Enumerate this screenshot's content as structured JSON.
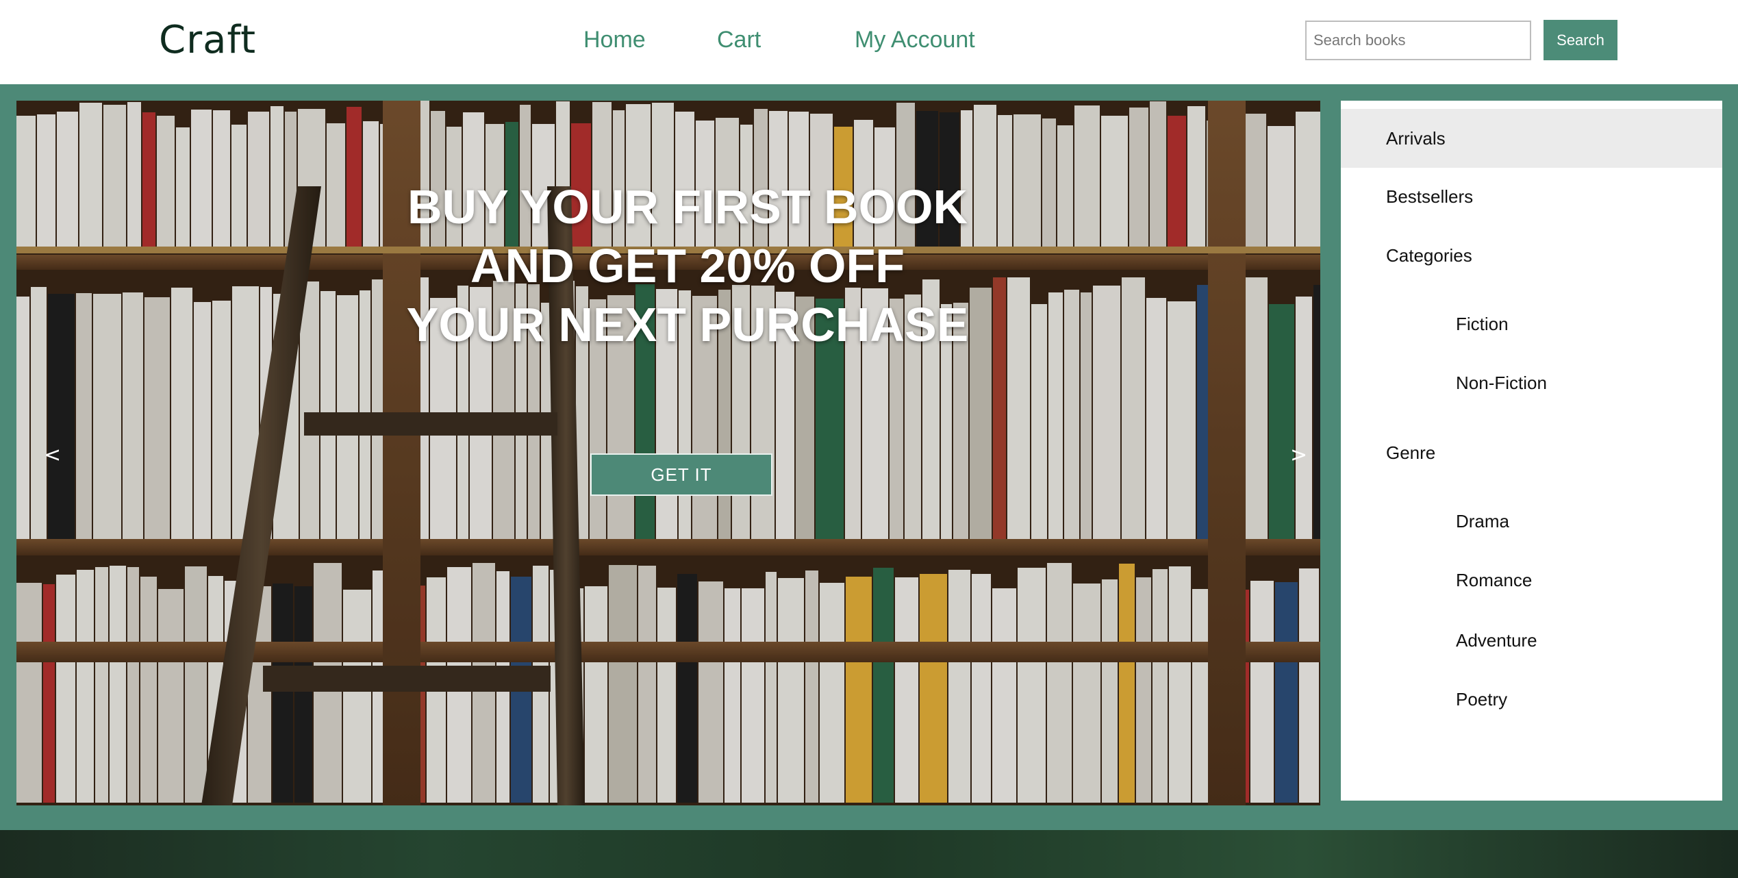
{
  "header": {
    "logo": "Craft",
    "nav": {
      "home": "Home",
      "cart": "Cart",
      "account": "My Account"
    },
    "search": {
      "placeholder": "Search books",
      "button_label": "Search"
    }
  },
  "hero": {
    "title": "BUY YOUR FIRST BOOK AND GET 20% OFF YOUR NEXT PURCHASE",
    "cta_label": "GET IT",
    "prev_arrow": "<",
    "next_arrow": ">"
  },
  "sidebar": {
    "items": [
      {
        "label": "Arrivals",
        "level": 0,
        "active": true
      },
      {
        "label": "Bestsellers",
        "level": 0
      },
      {
        "label": "Categories",
        "level": 0
      },
      {
        "label": "Fiction",
        "level": 1
      },
      {
        "label": "Non-Fiction",
        "level": 1
      },
      {
        "label": "Genre",
        "level": 0
      },
      {
        "label": "Drama",
        "level": 1
      },
      {
        "label": "Romance",
        "level": 1
      },
      {
        "label": "Adventure",
        "level": 1
      },
      {
        "label": "Poetry",
        "level": 1
      }
    ]
  },
  "colors": {
    "brand_green": "#4d8977",
    "nav_text": "#3f8e71",
    "logo_text": "#0f2c1f"
  },
  "icons": {
    "prev": "chevron-left-icon",
    "next": "chevron-right-icon"
  }
}
